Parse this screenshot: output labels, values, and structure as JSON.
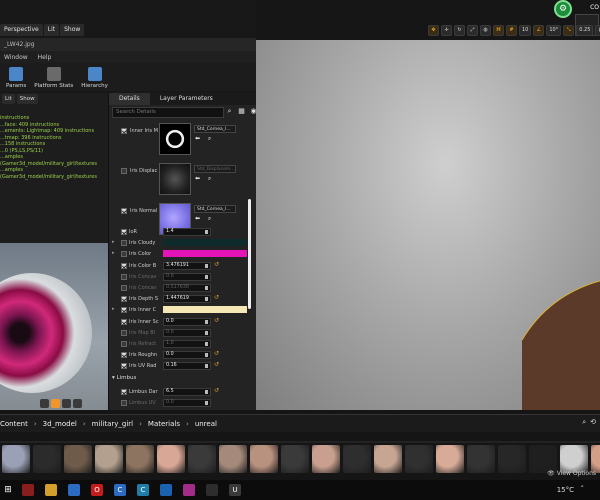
{
  "top_tabs": {
    "perspective": "Perspective",
    "lit": "Lit",
    "show": "Show"
  },
  "window": {
    "title": "_LW42.jpg",
    "menu": [
      "Window",
      "Help"
    ]
  },
  "ribbon": [
    {
      "label": "Params",
      "color": "#4b86c8"
    },
    {
      "label": "Platform Stats",
      "color": "#6a6a6a"
    },
    {
      "label": "Hierarchy",
      "color": "#4b86c8"
    }
  ],
  "preview": {
    "buttons": [
      "Lit",
      "Show"
    ],
    "stats": [
      "instructions",
      "...face: 409 instructions",
      "...ements: Lightmap: 409 instructions",
      "...tmap: 396 instructions",
      "...158 instructions",
      "...0 (PS,LS,PS/11)",
      "...amples (Gamer3d_model/military_girl/textures",
      "...amples (Gamer3d_model/military_girl/textures"
    ]
  },
  "details": {
    "tabs": [
      "Details",
      "Layer Parameters"
    ],
    "search_placeholder": "Search Details",
    "textures": [
      {
        "label": "Inner Iris M",
        "enabled": true,
        "asset": "Std_Cornea_I...",
        "kind": "ring"
      },
      {
        "label": "Iris Displac",
        "enabled": false,
        "asset": "Std_Displacem...",
        "kind": "dark"
      },
      {
        "label": "Iris Normal",
        "enabled": true,
        "asset": "Std_Cornea_I...",
        "kind": "normal"
      }
    ],
    "props": [
      {
        "arrow": "",
        "label": "IoR",
        "enabled": true,
        "value": "1.4",
        "dim": false,
        "reset": false
      },
      {
        "arrow": "▸",
        "label": "Iris Cloudy",
        "enabled": false,
        "swatch": "#0f2a2a",
        "dim": false,
        "reset": false
      },
      {
        "arrow": "▸",
        "label": "Iris Color",
        "enabled": false,
        "swatch": "#e414b6",
        "dim": false,
        "reset": false
      },
      {
        "arrow": "",
        "label": "Iris Color B",
        "enabled": true,
        "value": "3.476191",
        "dim": false,
        "reset": true
      },
      {
        "arrow": "",
        "label": "Iris Concav",
        "enabled": false,
        "value": "0.0",
        "dim": true,
        "reset": false
      },
      {
        "arrow": "",
        "label": "Iris Concav",
        "enabled": false,
        "value": "0.517638",
        "dim": true,
        "reset": false
      },
      {
        "arrow": "",
        "label": "Iris Depth S",
        "enabled": true,
        "value": "1.447619",
        "dim": false,
        "reset": true
      },
      {
        "arrow": "▸",
        "label": "Iris Inner C",
        "enabled": true,
        "swatch": "#f6e8b4",
        "dim": false,
        "reset": false
      },
      {
        "arrow": "",
        "label": "Iris Inner Sc",
        "enabled": true,
        "value": "0.0",
        "dim": false,
        "reset": true
      },
      {
        "arrow": "",
        "label": "Iris Map Bl",
        "enabled": false,
        "value": "0.0",
        "dim": true,
        "reset": false
      },
      {
        "arrow": "",
        "label": "Iris Refract",
        "enabled": false,
        "value": "1.0",
        "dim": true,
        "reset": false
      },
      {
        "arrow": "",
        "label": "Iris Roughn",
        "enabled": true,
        "value": "0.0",
        "dim": false,
        "reset": true
      },
      {
        "arrow": "",
        "label": "Iris UV Rad",
        "enabled": true,
        "value": "0.16",
        "dim": false,
        "reset": true
      }
    ],
    "section": "Limbus",
    "limbus_props": [
      {
        "arrow": "",
        "label": "Limbus Dar",
        "enabled": true,
        "value": "6.5",
        "dim": false,
        "reset": true
      },
      {
        "arrow": "",
        "label": "Limbus UV",
        "enabled": false,
        "value": "0.0",
        "dim": true,
        "reset": false
      },
      {
        "arrow": "",
        "label": "Limbus UV",
        "enabled": false,
        "value": "0.0",
        "dim": true,
        "reset": false
      }
    ]
  },
  "viewport": {
    "toolbar": [
      "10",
      "10°",
      "0.25",
      "4"
    ],
    "top_right_label": "CO"
  },
  "content_browser": {
    "crumbs": [
      "Content",
      "3d_model",
      "military_girl",
      "Materials",
      "unreal"
    ],
    "view_options": "View Options",
    "thumb_colors": [
      "#9aa0b5",
      "#2b2b2b",
      "#6e5b4a",
      "#b3a08e",
      "#8d7460",
      "#d9a796",
      "#3a3a3a",
      "#a58a7c",
      "#b9917f",
      "#3a3a3a",
      "#c9a08f",
      "#2e2e2e",
      "#c6a692",
      "#303030",
      "#d8ab98",
      "#333333",
      "#272727",
      "#1f1f1f",
      "#cfcfcf",
      "#d39f86",
      "#414141",
      "#5a3a6a",
      "#b89a8a",
      "#c8b3a6",
      "#9c8a80",
      "#c9a893",
      "#3a3a3a",
      "#8d8d8d",
      "#b69a87",
      "#2c2c2c",
      "#d2b9a6",
      "#737373"
    ]
  },
  "taskbar": {
    "icons": [
      {
        "name": "photo-app-icon",
        "color": "#8a1e1e",
        "glyph": ""
      },
      {
        "name": "file-explorer-icon",
        "color": "#d3a12b",
        "glyph": ""
      },
      {
        "name": "chrome-icon",
        "color": "#2b6cc2",
        "glyph": ""
      },
      {
        "name": "opera-icon",
        "color": "#c41b1b",
        "glyph": "O"
      },
      {
        "name": "c-app-icon",
        "color": "#2b6cc2",
        "glyph": "C"
      },
      {
        "name": "c-app2-icon",
        "color": "#1f7ea8",
        "glyph": "C"
      },
      {
        "name": "gallery-icon",
        "color": "#1b62b0",
        "glyph": ""
      },
      {
        "name": "winrar-icon",
        "color": "#a22c8a",
        "glyph": ""
      },
      {
        "name": "app-icon",
        "color": "#2d2d2d",
        "glyph": ""
      },
      {
        "name": "unreal-icon",
        "color": "#3a3a3a",
        "glyph": "U"
      }
    ],
    "temp": "15°C"
  }
}
